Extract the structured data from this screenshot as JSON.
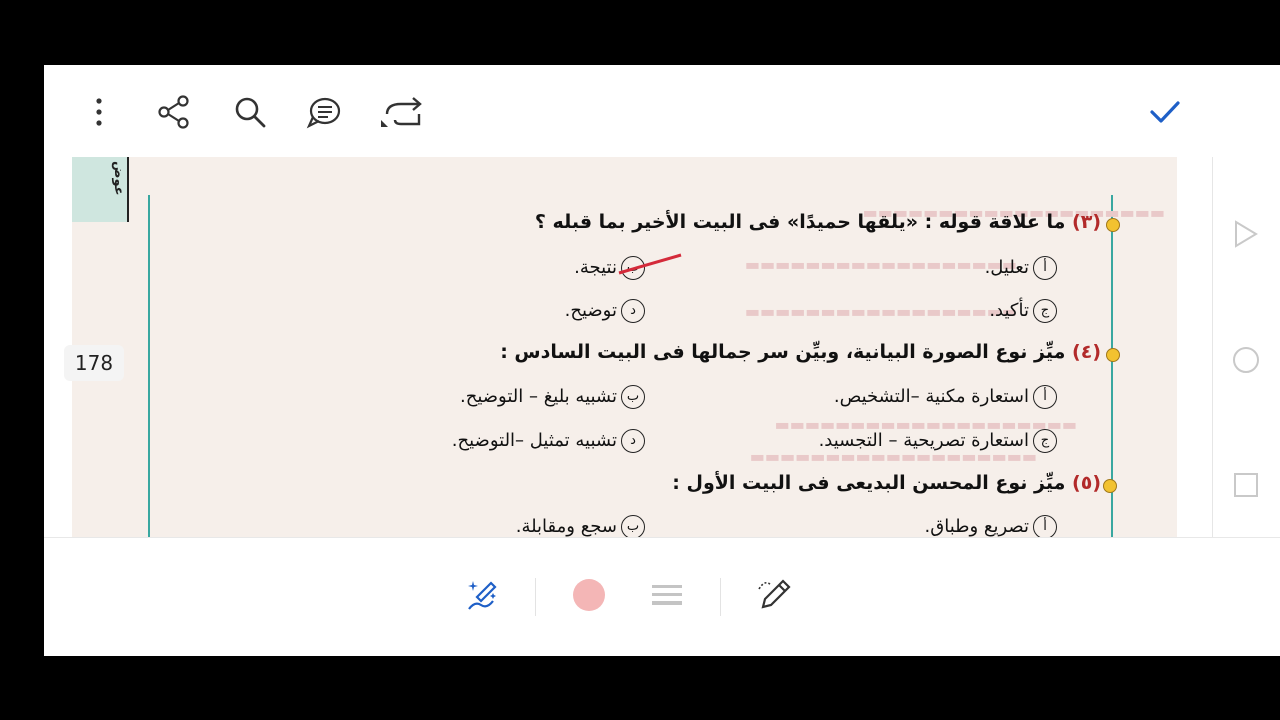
{
  "toolbar": {
    "more_icon": "more-vertical-icon",
    "share_icon": "share-icon",
    "search_icon": "search-icon",
    "comment_icon": "comment-icon",
    "undo_icon": "undo-icon",
    "done_icon": "checkmark-icon",
    "accent": "#1e5fc7"
  },
  "page": {
    "page_number": "178",
    "side_tab_text": "عوض"
  },
  "questions": [
    {
      "num": "(٣)",
      "text": "ما علاقة قوله : «يلقها حميدًا» فى البيت الأخير بما قبله ؟",
      "options": [
        {
          "letter": "أ",
          "text": "تعليل."
        },
        {
          "letter": "ب",
          "text": "نتيجة."
        },
        {
          "letter": "ج",
          "text": "تأكيد."
        },
        {
          "letter": "د",
          "text": "توضيح."
        }
      ]
    },
    {
      "num": "(٤)",
      "text": "ميِّز نوع الصورة البيانية، وبيِّن سر جمالها فى البيت السادس :",
      "options": [
        {
          "letter": "أ",
          "text": "استعارة مكنية –التشخيص."
        },
        {
          "letter": "ب",
          "text": "تشبيه بليغ – التوضيح."
        },
        {
          "letter": "ج",
          "text": "استعارة تصريحية – التجسيد."
        },
        {
          "letter": "د",
          "text": "تشبيه تمثيل –التوضيح."
        }
      ]
    },
    {
      "num": "(٥)",
      "text": "ميِّز نوع المحسن البديعى فى البيت الأول :",
      "options": [
        {
          "letter": "أ",
          "text": "تصريع وطباق."
        },
        {
          "letter": "ب",
          "text": "سجع ومقابلة."
        }
      ]
    }
  ],
  "side_panel": {
    "play_icon": "play-triangle-icon",
    "circle_icon": "circle-icon",
    "square_icon": "square-icon"
  },
  "bottom_bar": {
    "magic_pen_icon": "magic-pen-icon",
    "color_swatch": "#f4b6b6",
    "thickness_icon": "line-thickness-icon",
    "pencil_icon": "pencil-icon"
  }
}
